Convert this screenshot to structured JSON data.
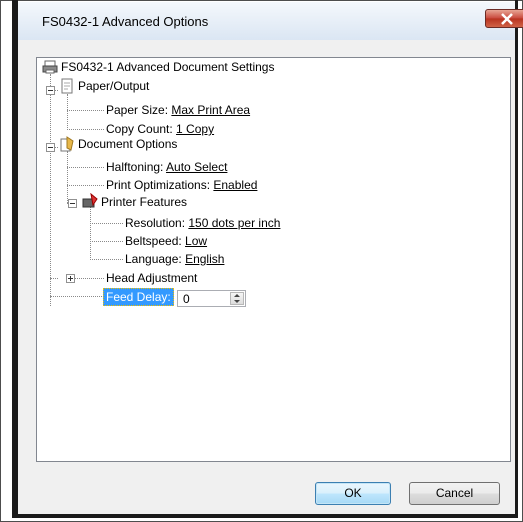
{
  "window": {
    "title": "FS0432-1 Advanced Options"
  },
  "tree": {
    "root_label": "FS0432-1 Advanced Document Settings",
    "paper_output": {
      "label": "Paper/Output",
      "paper_size_label": "Paper Size: ",
      "paper_size_value": "Max Print Area",
      "copy_count_label": "Copy Count: ",
      "copy_count_value": "1 Copy"
    },
    "document_options": {
      "label": "Document Options",
      "halftoning_label": "Halftoning: ",
      "halftoning_value": "Auto Select",
      "print_opt_label": "Print Optimizations: ",
      "print_opt_value": "Enabled",
      "printer_features": {
        "label": "Printer Features",
        "resolution_label": "Resolution: ",
        "resolution_value": "150 dots per inch",
        "beltspeed_label": "Beltspeed: ",
        "beltspeed_value": "Low",
        "language_label": "Language: ",
        "language_value": "English"
      }
    },
    "head_adjustment": {
      "label": "Head Adjustment"
    },
    "feed_delay": {
      "label": "Feed Delay:",
      "value": "0"
    }
  },
  "buttons": {
    "ok": "OK",
    "cancel": "Cancel"
  },
  "colors": {
    "selection": "#3399ff",
    "ok_border": "#3c7fb1",
    "close_button": "#c8463a"
  }
}
